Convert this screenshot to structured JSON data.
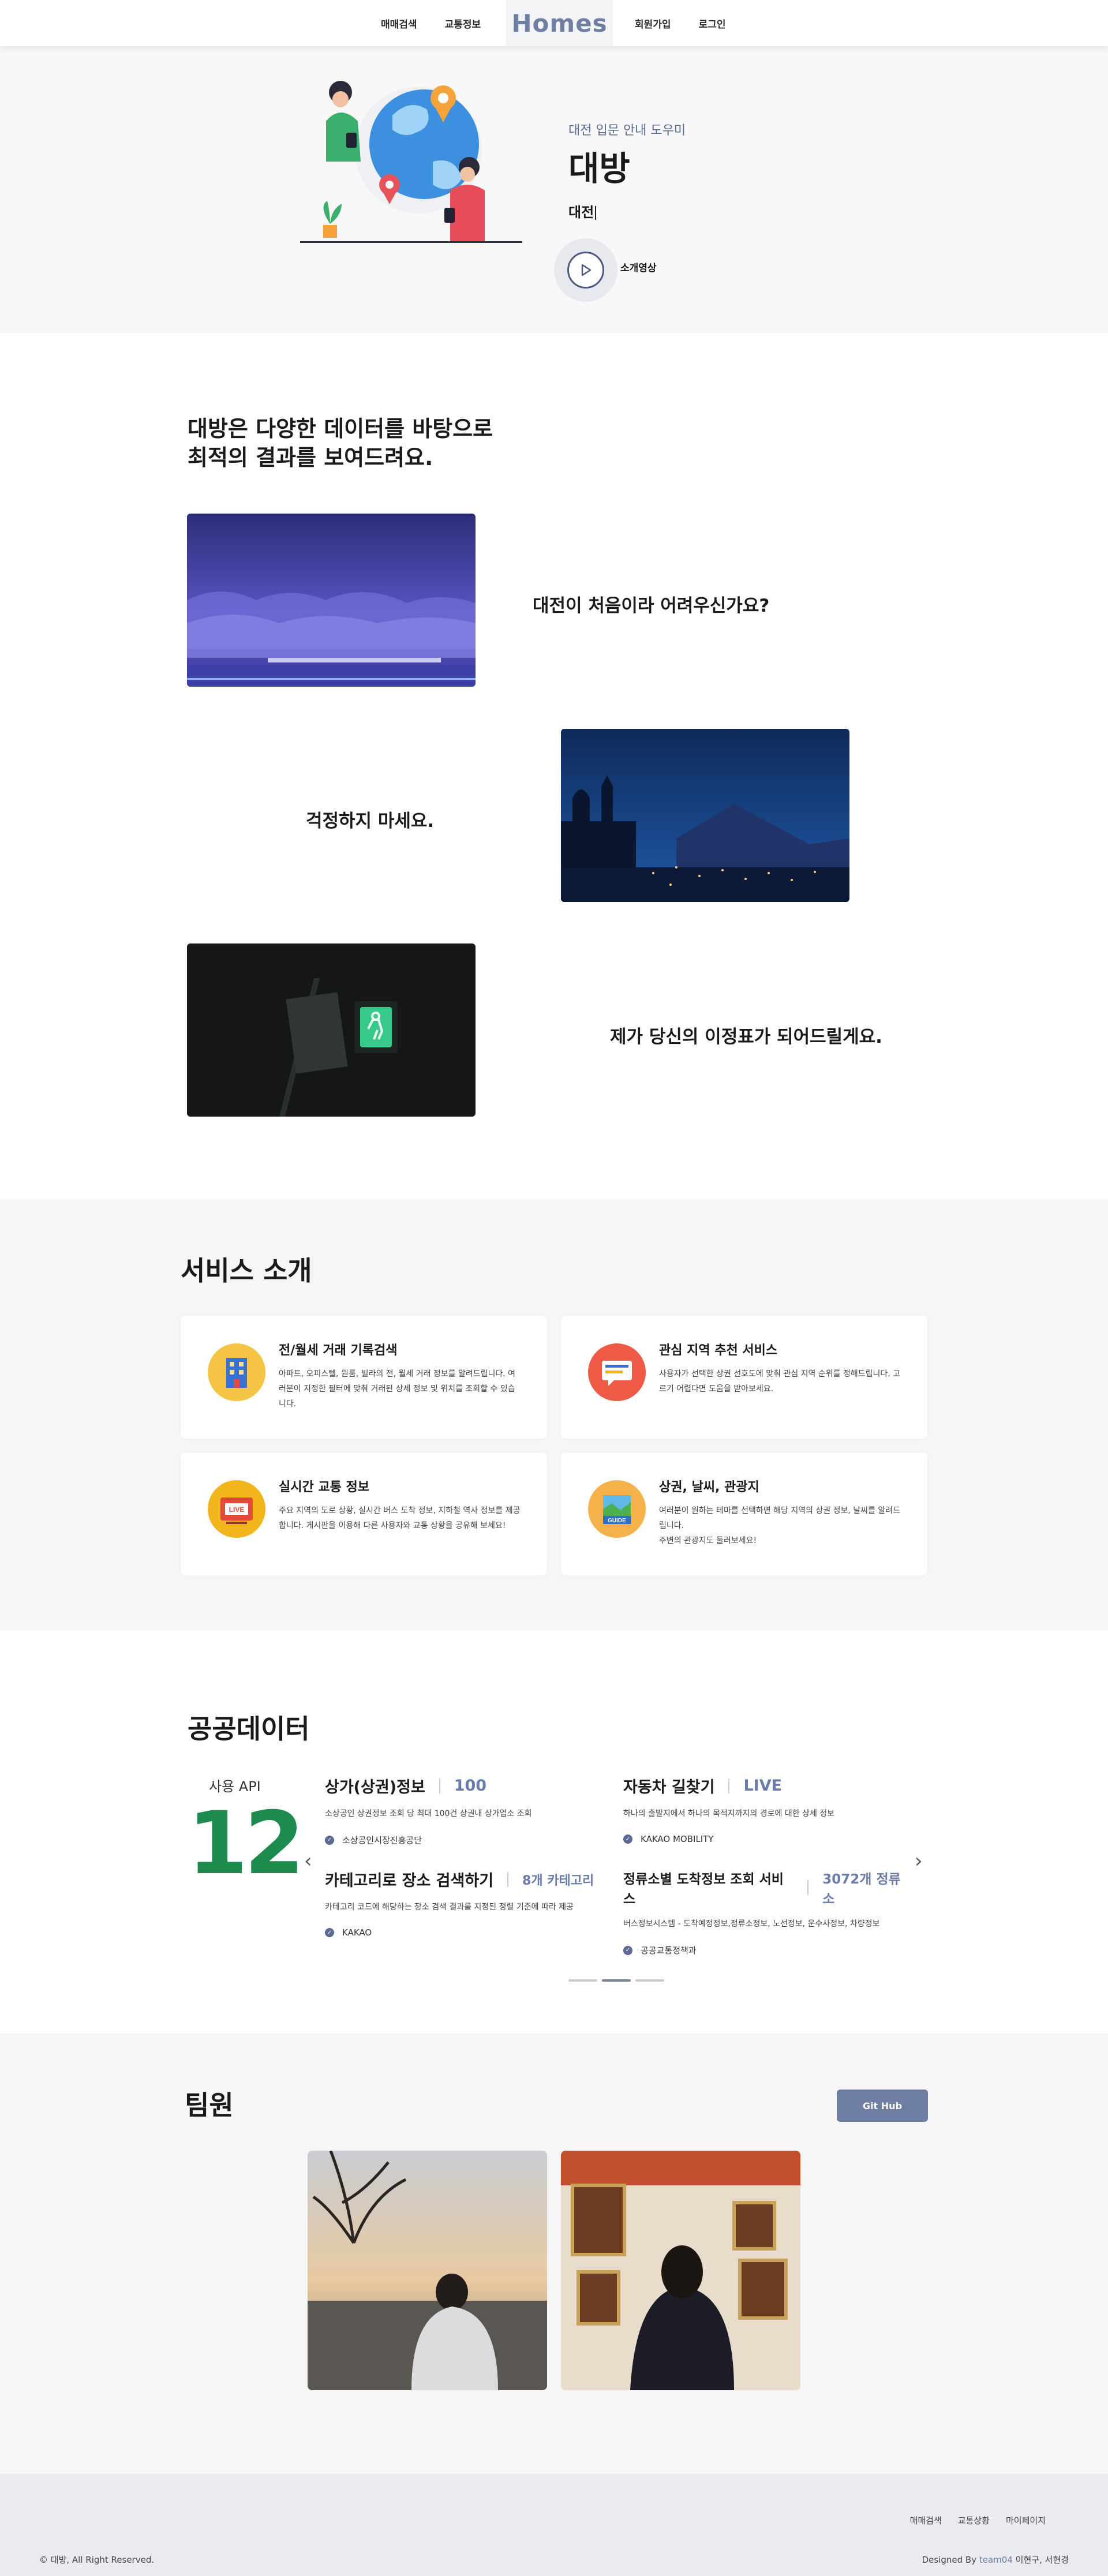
{
  "header": {
    "nav_left": [
      "매매검색",
      "교통정보"
    ],
    "logo": "Homes",
    "nav_right": [
      "회원가입",
      "로그인"
    ]
  },
  "hero": {
    "subtitle": "대전 입문 안내 도우미",
    "title": "대방",
    "typed_text": "대전",
    "play_label": "소개영상"
  },
  "intro": {
    "heading_line1": "대방은 다양한 데이터를 바탕으로",
    "heading_line2": "최적의 결과를 보여드려요.",
    "rows": [
      {
        "text": "대전이 처음이라 어려우신가요?"
      },
      {
        "text": "걱정하지 마세요."
      },
      {
        "text": "제가 당신의 이정표가 되어드릴게요."
      }
    ]
  },
  "service": {
    "heading": "서비스 소개",
    "cards": [
      {
        "title": "전/월세 거래 기록검색",
        "desc": "아파트, 오피스텔, 원룸, 빌라의 전, 월세 거래 정보를 알려드립니다. 여러분이 지정한 필터에 맞춰 거래된 상세 정보 및 위치를 조회할 수 있습니다.",
        "icon": "building-icon",
        "color": "#f6c445"
      },
      {
        "title": "관심 지역 추천 서비스",
        "desc": "사용자가 선택한 상권 선호도에 맞춰 관심 지역 순위를 정해드립니다. 고르기 어렵다면 도움을 받아보세요.",
        "icon": "chat-bubble-icon",
        "color": "#ee5a45"
      },
      {
        "title": "실시간 교통 정보",
        "desc": "주요 지역의 도로 상황, 실시간 버스 도착 정보, 지하철 역사 정보를 제공합니다. 게시판을 이용해 다른 사용자와 교통 상황을 공유해 보세요!",
        "icon": "live-tv-icon",
        "color": "#f3b51c"
      },
      {
        "title": "상권, 날씨, 관광지",
        "desc": "여러분이 원하는 테마를 선택하면 해당 지역의 상권 정보, 날씨를 알려드립니다.\n주변의 관광지도 둘러보세요!",
        "icon": "guide-map-icon",
        "color": "#f6b24a"
      }
    ]
  },
  "public_data": {
    "heading": "공공데이터",
    "api_label": "사용 API",
    "api_count": "12",
    "items": [
      {
        "title": "상가(상권)정보",
        "num": "100",
        "desc": "소상공인 상권정보 조회 당 최대 100건 상권내 상가업소 조회",
        "source": "소상공인시장진흥공단"
      },
      {
        "title": "자동차 길찾기",
        "num": "LIVE",
        "desc": "하나의 출발지에서 하나의 목적지까지의 경로에 대한 상세 정보",
        "source": "KAKAO MOBILITY"
      },
      {
        "title": "카테고리로 장소 검색하기",
        "num": "8개 카테고리",
        "desc": "카테고리 코드에 해당하는 장소 검색 결과를 지정된 정렬 기준에 따라 제공",
        "source": "KAKAO"
      },
      {
        "title": "정류소별 도착정보 조회 서비스",
        "num": "3072개 정류소",
        "desc": "버스정보시스템 - 도착예정정보,정류소정보, 노선정보, 운수사정보, 차량정보",
        "source": "공공교통정책과"
      }
    ],
    "prev_arrow": "‹",
    "next_arrow": "›"
  },
  "team": {
    "heading": "팀원",
    "github_button": "Git Hub"
  },
  "footer": {
    "links": [
      "매매검색",
      "교통상황",
      "마이페이지"
    ],
    "copyright": "© 대방, All Right Reserved.",
    "designed_prefix": "Designed By ",
    "team_name": "team04",
    "members": " 이현구, 서현경"
  }
}
